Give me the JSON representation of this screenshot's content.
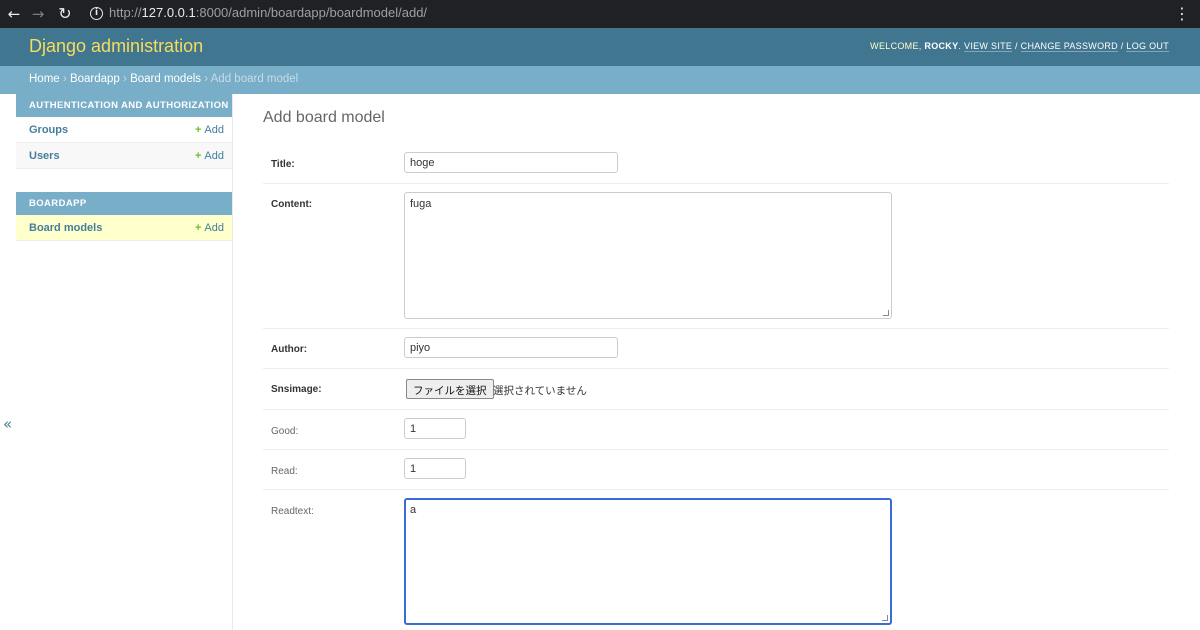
{
  "browser": {
    "url_scheme": "http://",
    "url_host": "127.0.0.1",
    "url_rest": ":8000/admin/boardapp/boardmodel/add/"
  },
  "header": {
    "branding": "Django administration",
    "welcome": "WELCOME, ",
    "username": "ROCKY",
    "links": [
      "VIEW SITE",
      "CHANGE PASSWORD",
      "LOG OUT"
    ]
  },
  "breadcrumbs": {
    "items": [
      "Home",
      "Boardapp",
      "Board models"
    ],
    "current": "Add board model",
    "separator": "›"
  },
  "sidebar": {
    "modules": [
      {
        "caption": "AUTHENTICATION AND AUTHORIZATION",
        "models": [
          {
            "name": "Groups",
            "add": "Add"
          },
          {
            "name": "Users",
            "add": "Add"
          }
        ]
      },
      {
        "caption": "BOARDAPP",
        "models": [
          {
            "name": "Board models",
            "add": "Add"
          }
        ]
      }
    ],
    "toggle": "«"
  },
  "form": {
    "title": "Add board model",
    "fields": {
      "title": {
        "label": "Title:",
        "value": "hoge"
      },
      "content": {
        "label": "Content:",
        "value": "fuga"
      },
      "author": {
        "label": "Author:",
        "value": "piyo"
      },
      "snsimage": {
        "label": "Snsimage:",
        "button": "ファイルを選択",
        "status": "選択されていません"
      },
      "good": {
        "label": "Good:",
        "value": "1"
      },
      "read": {
        "label": "Read:",
        "value": "1"
      },
      "readtext": {
        "label": "Readtext:",
        "value": "a"
      }
    }
  },
  "colors": {
    "header_bg": "#417690",
    "branding": "#f5dd5d",
    "breadcrumb_bg": "#79aec8",
    "link": "#447e9b",
    "add_plus": "#70bf2b",
    "current_row": "#ffffcc",
    "focus_border": "#3b6bd6"
  }
}
